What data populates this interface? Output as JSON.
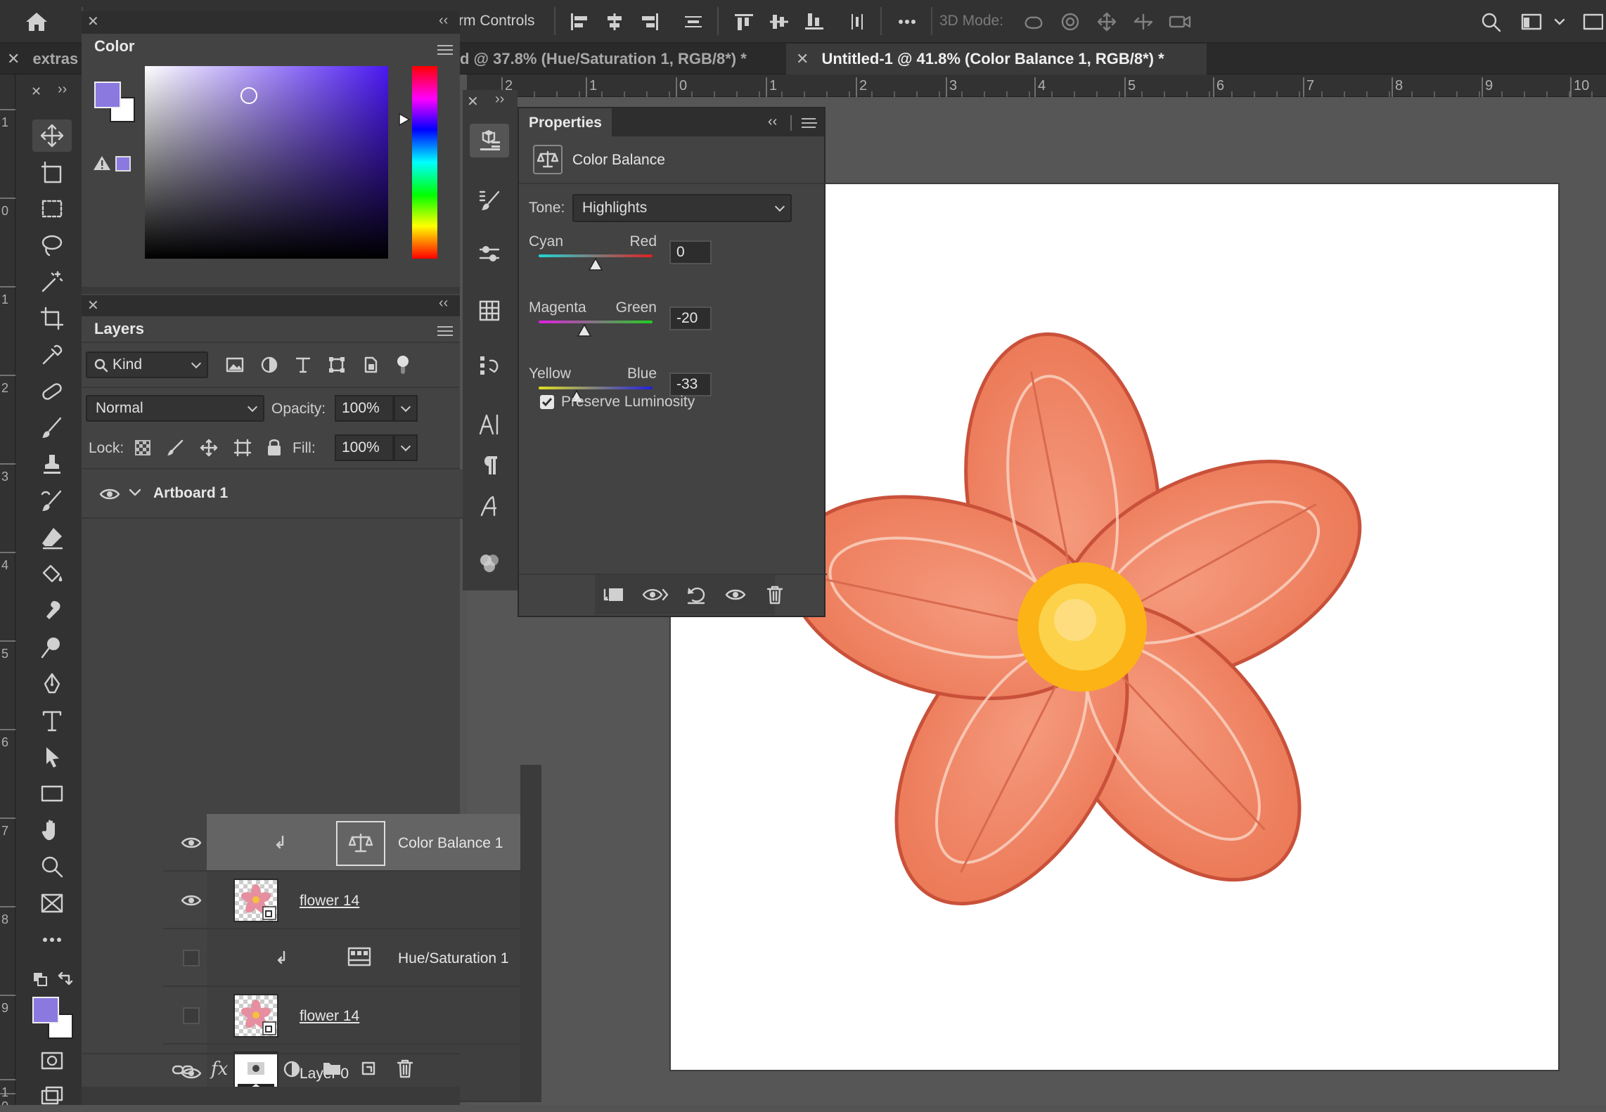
{
  "optbar": {
    "transform_controls_label": "rm Controls",
    "mode_3d_label": "3D Mode:"
  },
  "tabs": [
    {
      "label": "extras",
      "active": false
    },
    {
      "label": "d @ 37.8% (Hue/Saturation 1, RGB/8*) *",
      "active": false
    },
    {
      "label": "Untitled-1 @ 41.8% (Color Balance 1, RGB/8*) *",
      "active": true
    }
  ],
  "ruler": {
    "h_labels": [
      "2",
      "1",
      "0",
      "1",
      "2",
      "3",
      "4",
      "5",
      "6",
      "7",
      "8",
      "9",
      "10"
    ],
    "v_labels": [
      "1",
      "0",
      "1",
      "2",
      "3",
      "4",
      "5",
      "6",
      "7",
      "8",
      "9",
      "1",
      "0"
    ]
  },
  "color_panel": {
    "title": "Color",
    "foreground": "#8b79e0",
    "background": "#ffffff",
    "hue_color": "#4b18f2"
  },
  "layers_panel": {
    "title": "Layers",
    "filter_kind": "Kind",
    "blend_mode": "Normal",
    "opacity_label": "Opacity:",
    "opacity": "100%",
    "lock_label": "Lock:",
    "fill_label": "Fill:",
    "fill": "100%",
    "artboard": "Artboard 1",
    "layers": [
      {
        "name": "Color Balance 1",
        "visible": true,
        "selected": true,
        "type": "adjustment"
      },
      {
        "name": "flower 14",
        "visible": true,
        "selected": false,
        "type": "smart"
      },
      {
        "name": "Hue/Saturation 1",
        "visible": false,
        "selected": false,
        "type": "adjustment"
      },
      {
        "name": "flower 14",
        "visible": false,
        "selected": false,
        "type": "smart"
      },
      {
        "name": "Layer 0",
        "visible": true,
        "selected": false,
        "type": "pixel"
      }
    ]
  },
  "properties_panel": {
    "title": "Properties",
    "adjustment": "Color Balance",
    "tone_label": "Tone:",
    "tone": "Highlights",
    "sliders": [
      {
        "left": "Cyan",
        "right": "Red",
        "value": "0",
        "position": 0.5
      },
      {
        "left": "Magenta",
        "right": "Green",
        "value": "-20",
        "position": 0.4
      },
      {
        "left": "Yellow",
        "right": "Blue",
        "value": "-33",
        "position": 0.335
      }
    ],
    "preserve_luminosity_label": "Preserve Luminosity",
    "preserve_luminosity": true
  }
}
